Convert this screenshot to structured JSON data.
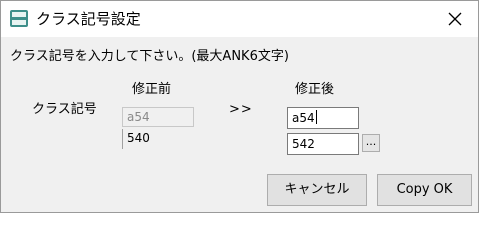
{
  "window": {
    "title": "クラス記号設定"
  },
  "instruction": "クラス記号を入力して下さい。(最大ANK6文字)",
  "headers": {
    "before": "修正前",
    "after": "修正後"
  },
  "row_label": "クラス記号",
  "arrow": ">>",
  "before": {
    "value_top": "a54",
    "value_bottom": "540"
  },
  "after": {
    "value_top": "a54",
    "value_bottom": "542"
  },
  "buttons": {
    "browse": "...",
    "cancel": "キャンセル",
    "copy_ok": "Copy OK"
  },
  "icons": {
    "app": "app-icon",
    "close": "close-icon"
  },
  "colors": {
    "app_icon": "#3e8f8a",
    "titlebar": "#ffffff",
    "dialog": "#f0f0f0"
  }
}
